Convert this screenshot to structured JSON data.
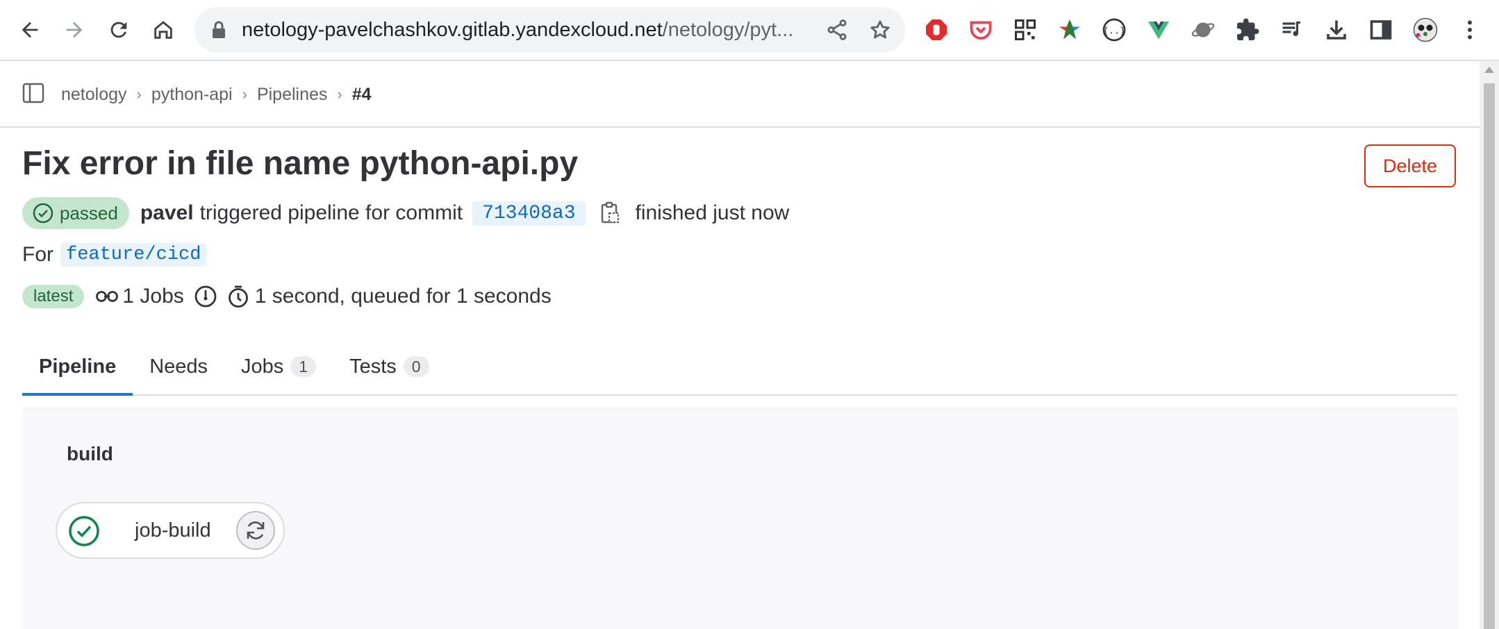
{
  "browser": {
    "url_host": "netology-pavelchashkov.gitlab.yandexcloud.net",
    "url_path": "/netology/pyt..."
  },
  "breadcrumb": {
    "items": [
      "netology",
      "python-api",
      "Pipelines",
      "#4"
    ]
  },
  "pipeline": {
    "title": "Fix error in file name python-api.py",
    "delete_label": "Delete",
    "status": "passed",
    "user": "pavel",
    "triggered_text": "triggered pipeline for commit",
    "commit_sha": "713408a3",
    "finished_text": "finished just now",
    "for_label": "For",
    "branch": "feature/cicd",
    "latest_label": "latest",
    "jobs_count_text": "1 Jobs",
    "duration_text": "1 second, queued for 1 seconds"
  },
  "tabs": [
    {
      "label": "Pipeline",
      "count": null
    },
    {
      "label": "Needs",
      "count": null
    },
    {
      "label": "Jobs",
      "count": "1"
    },
    {
      "label": "Tests",
      "count": "0"
    }
  ],
  "graph": {
    "stage_name": "build",
    "job_name": "job-build"
  },
  "colors": {
    "success": "#108548",
    "danger": "#dd2b0e",
    "link": "#1068bf",
    "tab_active": "#1f75cb"
  }
}
